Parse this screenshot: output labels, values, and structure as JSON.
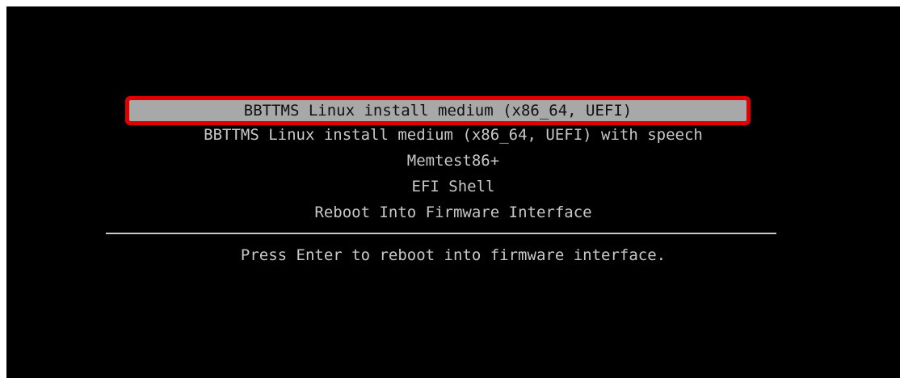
{
  "boot_menu": {
    "entries": [
      {
        "label": "BBTTMS Linux install medium (x86_64, UEFI)",
        "selected": true
      },
      {
        "label": "BBTTMS Linux install medium (x86_64, UEFI) with speech",
        "selected": false
      },
      {
        "label": "Memtest86+",
        "selected": false
      },
      {
        "label": "EFI Shell",
        "selected": false
      },
      {
        "label": "Reboot Into Firmware Interface",
        "selected": false
      }
    ],
    "help_text": "Press Enter to reboot into firmware interface."
  },
  "colors": {
    "background": "#000000",
    "text": "#c8c8c8",
    "selection_background": "#a8a8a8",
    "selection_text": "#101010",
    "highlight_outline": "#e00000"
  }
}
